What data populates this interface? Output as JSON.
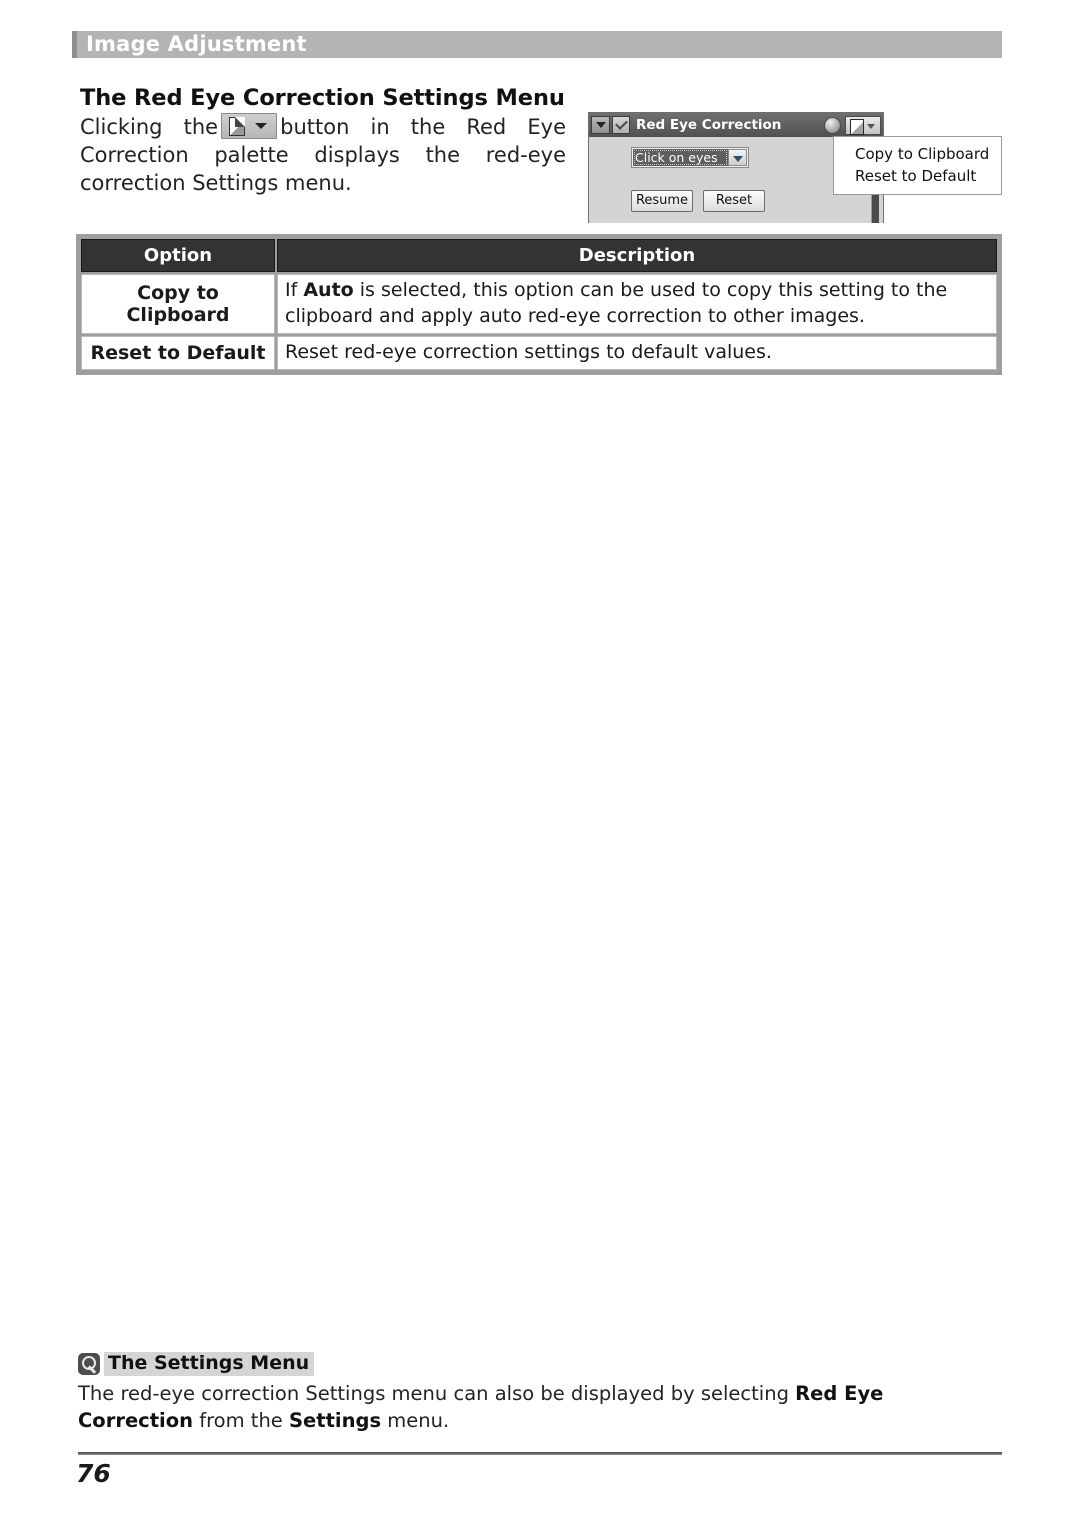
{
  "banner": {
    "title": "Image Adjustment"
  },
  "section": {
    "heading": "The Red Eye Correction Settings Menu",
    "paragraph_before": "Clicking the",
    "paragraph_after": "button in the Red Eye Correction palette displays the red-eye correction Settings menu.",
    "inline_button_icon": "settings-page-dropdown-icon"
  },
  "figure": {
    "palette": {
      "title": "Red Eye Correction",
      "expand_icon": "triangle-down-icon",
      "enable_checkbox_icon": "checkmark-icon",
      "knob_icon": "circle-knob-icon",
      "settings_button_icon": "page-dropdown-icon",
      "combo_value": "Click on eyes",
      "combo_arrow_icon": "chevron-down-icon",
      "buttons": [
        "Resume",
        "Reset"
      ]
    },
    "context_menu": {
      "items": [
        "Copy to Clipboard",
        "Reset to Default"
      ]
    }
  },
  "options_table": {
    "headers": [
      "Option",
      "Description"
    ],
    "rows": [
      {
        "option": "Copy to Clipboard",
        "description_lead": "If",
        "description_bold": "Auto",
        "description_rest": "is selected, this option can be used to copy this setting to the clipboard and apply auto red-eye correction to other images."
      },
      {
        "option": "Reset to Default",
        "description_lead": "",
        "description_bold": "",
        "description_rest": "Reset red-eye correction settings to default values."
      }
    ]
  },
  "note": {
    "icon": "magnifier-note-icon",
    "title": "The Settings Menu",
    "text_part1": "The red-eye correction Settings menu can also be displayed by selecting ",
    "text_bold1": "Red Eye Correction",
    "text_part2": " from the ",
    "text_bold2": "Settings",
    "text_part3": " menu."
  },
  "footer": {
    "page_number": "76"
  },
  "colors": {
    "banner_bg": "#b4b4b4",
    "banner_edge": "#8e8e8e",
    "table_header_bg": "#333333",
    "table_border": "#9e9e9e",
    "note_highlight": "#d5d5d5"
  }
}
